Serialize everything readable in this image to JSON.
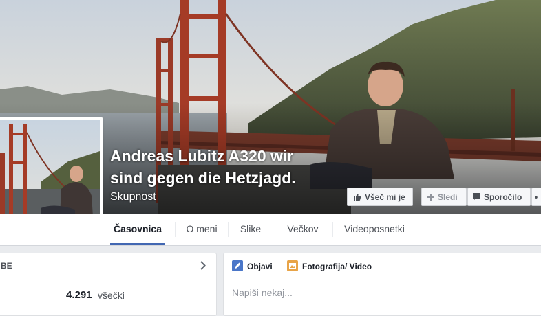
{
  "page": {
    "name_line1": "Andreas Lubitz A320 wir",
    "name_line2": "sind gegen die Hetzjagd.",
    "category": "Skupnost"
  },
  "cover_buttons": {
    "like": "Všeč mi je",
    "follow": "Sledi",
    "message": "Sporočilo",
    "more": "•"
  },
  "nav": {
    "tabs": [
      "Časovnica",
      "O meni",
      "Slike",
      "Večkov",
      "Videoposnetki"
    ],
    "active": "Časovnica"
  },
  "left_card": {
    "title": "BE",
    "count": "4.291",
    "count_label": "všečki"
  },
  "composer": {
    "tab_post": "Objavi",
    "tab_photo": "Fotografija/ Video",
    "placeholder": "Napiši nekaj..."
  },
  "colors": {
    "accent": "#4267b2",
    "background": "#e9ebee"
  }
}
